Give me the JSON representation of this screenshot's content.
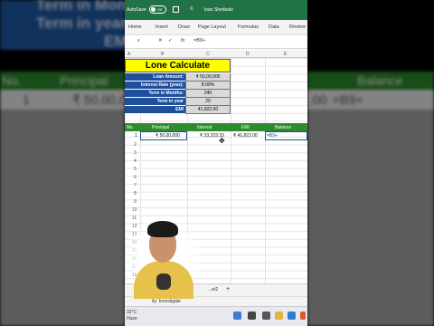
{
  "background": {
    "titles": [
      "Term in Months",
      "Term in year",
      "EMI"
    ],
    "green_headers_left": [
      "No.",
      "Principal"
    ],
    "green_headers_right": [
      "Balance"
    ],
    "row_left": [
      "1",
      "₹ 50,00,00"
    ],
    "row_right": [
      ".00",
      "=B9+"
    ]
  },
  "titlebar": {
    "autosave": "AutoSave",
    "toggle": "Off",
    "separator": "≡",
    "workbook": "loan Sheduale"
  },
  "ribbon": {
    "tabs": [
      "Home",
      "Insert",
      "Draw",
      "Page Layout",
      "Formulas",
      "Data",
      "Review"
    ]
  },
  "formula_bar": {
    "namebox": "v",
    "cancel": "✕",
    "enter": "✓",
    "fx": "fx",
    "formula": "=B9+"
  },
  "columns": [
    "A",
    "B",
    "C",
    "D",
    "E"
  ],
  "calculator": {
    "title": "Lone Calculate",
    "rows": [
      {
        "label": "Loan Amount:",
        "value": "₹ 50,00,000"
      },
      {
        "label": "Interest Rate (year):",
        "value": "8.00%"
      },
      {
        "label": "Term in Months:",
        "value": "240"
      },
      {
        "label": "Term in year",
        "value": "20"
      },
      {
        "label": "EMI",
        "value": "41,822.00"
      }
    ]
  },
  "table": {
    "headers": [
      "No.",
      "Principal",
      "Interest",
      "EMI",
      "Balance"
    ],
    "row1": [
      "1",
      "₹ 50,00,000",
      "₹ 33,333.33",
      "₹ 41,822.00",
      "=B9+"
    ],
    "row_numbers": [
      "1",
      "2",
      "3",
      "4",
      "5",
      "6",
      "7",
      "8",
      "9",
      "10",
      "11",
      "12",
      "13",
      "14",
      "15",
      "16",
      "17",
      "18",
      "19",
      "20"
    ]
  },
  "sheet_tabs": {
    "add": "+",
    "sheet": "...et2"
  },
  "status": {
    "accessibility": "ity: Investigate"
  },
  "taskbar": {
    "weather": "32°C",
    "weather_sub": "Haze"
  },
  "colors": {
    "excel_green": "#217346",
    "header_blue": "#1f4e9a",
    "title_yellow": "#ffff00",
    "table_green": "#2e8b2e"
  }
}
